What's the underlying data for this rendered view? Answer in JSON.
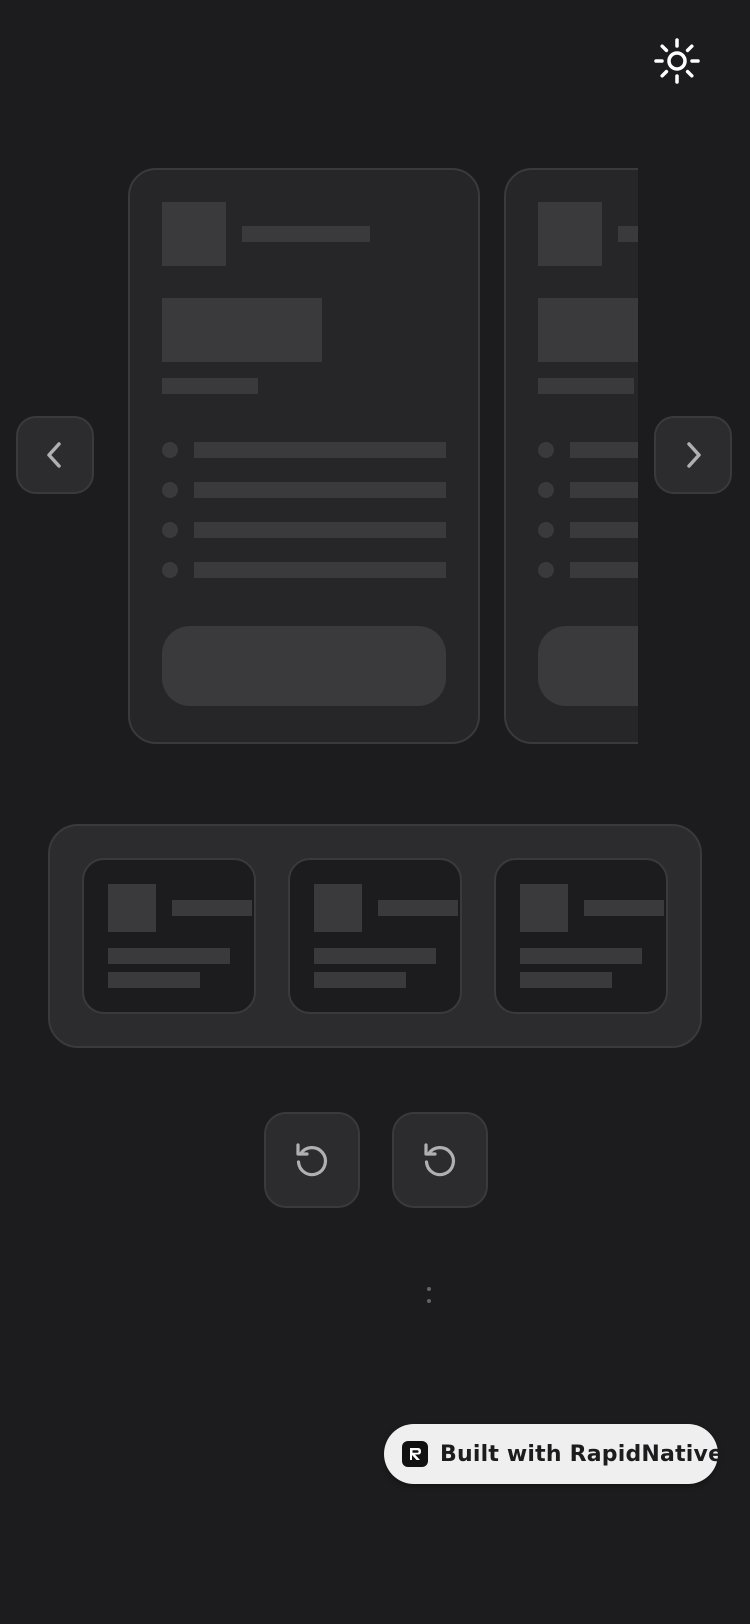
{
  "colors": {
    "background": "#1c1c1e",
    "card": "#262628",
    "border": "#3a3a3c",
    "placeholder": "#3a3a3c",
    "icon": "#b0b0b4",
    "badge_bg": "#efefef",
    "badge_text": "#1c1c1e"
  },
  "header": {
    "theme_icon": "sun-icon"
  },
  "carousel": {
    "prev_icon": "chevron-left-icon",
    "next_icon": "chevron-right-icon",
    "cards": [
      {
        "bullets": 4
      },
      {
        "bullets": 4
      }
    ]
  },
  "mini_panel": {
    "cards": 3
  },
  "controls": {
    "reset_icons": [
      "rotate-ccw-icon",
      "rotate-ccw-icon"
    ]
  },
  "pagination": {
    "icon": "more-vertical-icon"
  },
  "badge": {
    "label": "Built with RapidNative",
    "logo_icon": "rapidnative-logo-icon"
  }
}
